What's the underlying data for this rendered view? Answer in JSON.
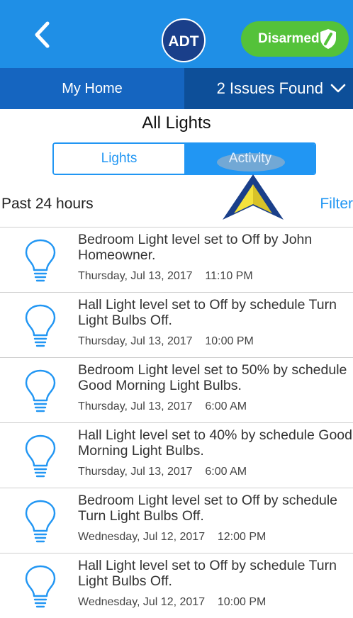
{
  "header": {
    "logo_text": "ADT",
    "status_label": "Disarmed",
    "colors": {
      "bar": "#1f8fe6",
      "status": "#54c23a",
      "logo": "#1a3f8a"
    }
  },
  "subnav": {
    "home_label": "My Home",
    "issues_label": "2 Issues Found"
  },
  "page": {
    "title": "All Lights",
    "tabs": [
      {
        "label": "Lights",
        "selected": false
      },
      {
        "label": "Activity",
        "selected": true
      }
    ],
    "range_label": "Past 24 hours",
    "filter_label": "Filter"
  },
  "activity": [
    {
      "message": "Bedroom Light level set to Off by John Homeowner.",
      "timestamp": "Thursday, Jul 13, 2017    11:10 PM"
    },
    {
      "message": "Hall Light level set to Off by schedule Turn Light Bulbs Off.",
      "timestamp": "Thursday, Jul 13, 2017    10:00 PM"
    },
    {
      "message": "Bedroom Light level set to 50% by schedule Good Morning Light Bulbs.",
      "timestamp": "Thursday, Jul 13, 2017    6:00 AM"
    },
    {
      "message": "Hall Light level set to 40% by schedule Good Morning Light Bulbs.",
      "timestamp": "Thursday, Jul 13, 2017    6:00 AM"
    },
    {
      "message": "Bedroom Light level set to Off by schedule Turn Light Bulbs Off.",
      "timestamp": "Wednesday, Jul 12, 2017    12:00 PM"
    },
    {
      "message": "Hall Light level set to Off by schedule Turn Light Bulbs Off.",
      "timestamp": "Wednesday, Jul 12, 2017    10:00 PM"
    }
  ],
  "icons": {
    "back": "chevron-left-icon",
    "status": "shield-icon",
    "issues": "chevron-down-icon",
    "row": "lightbulb-icon",
    "callout": "arrow-pointer-icon"
  }
}
